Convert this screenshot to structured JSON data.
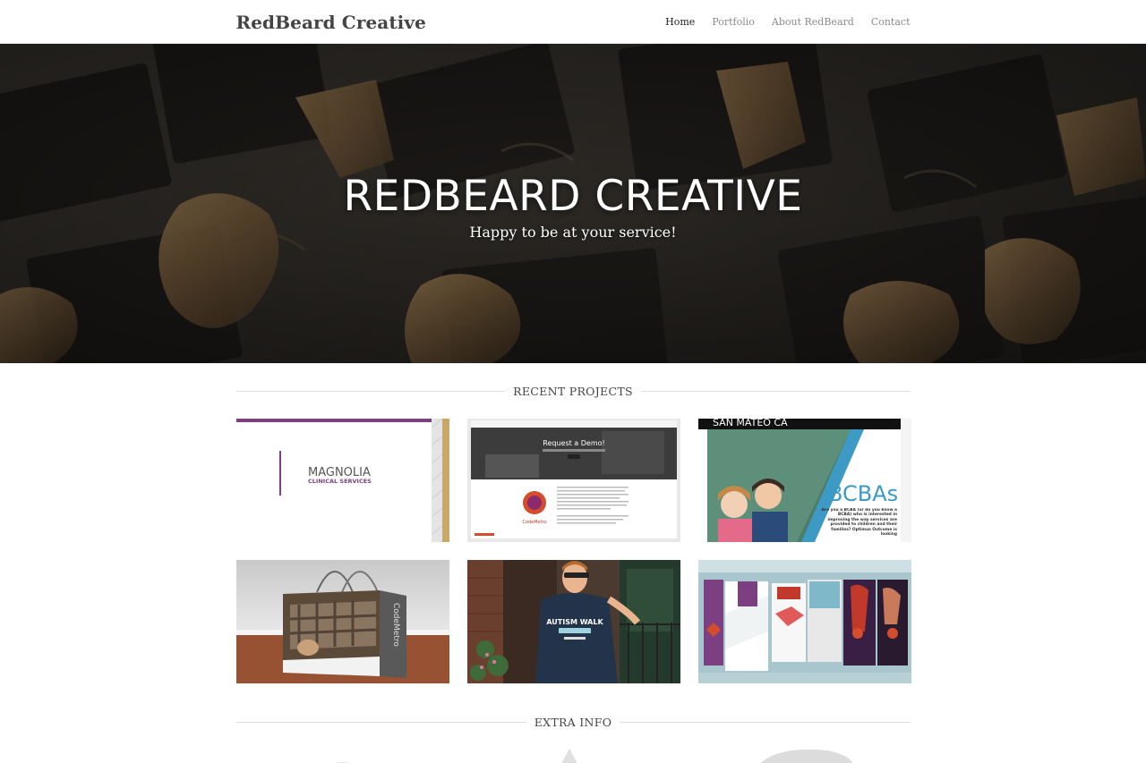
{
  "header": {
    "brand": "RedBeard Creative",
    "nav": [
      {
        "label": "Home",
        "active": true
      },
      {
        "label": "Portfolio",
        "active": false
      },
      {
        "label": "About RedBeard",
        "active": false
      },
      {
        "label": "Contact",
        "active": false
      }
    ]
  },
  "hero": {
    "title": "REDBEARD CREATIVE",
    "subtitle": "Happy to be at your service!"
  },
  "recent_projects": {
    "heading": "RECENT PROJECTS",
    "tiles": [
      {
        "magnolia_line1": "MAGNOLIA",
        "magnolia_line2": "CLINICAL SERVICES"
      },
      {
        "demo_text": "Request a Demo!",
        "logo_text": "CodeMetro"
      },
      {
        "top_text": "SAN MATEO CA",
        "big_text": "BCBAs",
        "body_text": "Are you a BCBA (or do you know a BCBA) who is interested in improving the way services are provided to children and their families? Optimus Outcome is looking"
      },
      {
        "bag_text": "CodeMetro"
      },
      {
        "shirt_text": "AUTISM WALK"
      },
      {}
    ]
  },
  "extra_info": {
    "heading": "EXTRA INFO"
  },
  "colors": {
    "accent_purple": "#7b3f82",
    "bcba_blue": "#3d9ac4",
    "gold": "#c9a86a",
    "nav_active": "#222222",
    "nav_inactive": "#8a8a8a"
  }
}
